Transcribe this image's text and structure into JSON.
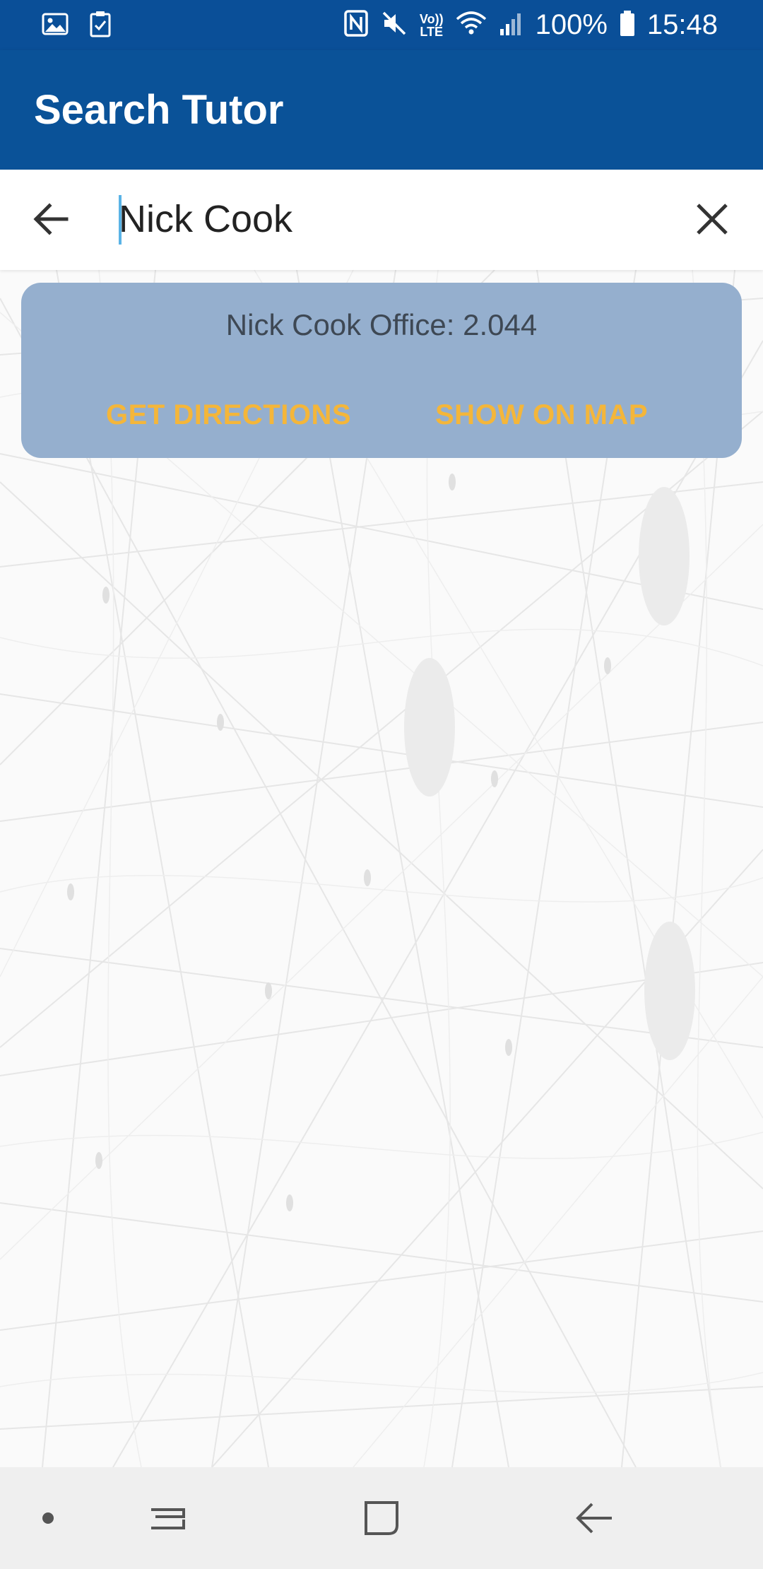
{
  "status_bar": {
    "battery_text": "100%",
    "time": "15:48",
    "lte_top": "Vo))",
    "lte_bottom": "LTE",
    "icons": [
      "gallery-icon",
      "clipboard-check-icon",
      "nfc-icon",
      "mute-icon",
      "volte-icon",
      "wifi-icon",
      "signal-icon",
      "battery-icon"
    ]
  },
  "app_bar": {
    "title": "Search Tutor"
  },
  "search": {
    "value": "Nick Cook",
    "icons": [
      "arrow-back-icon",
      "close-icon"
    ]
  },
  "result": {
    "text": "Nick Cook Office: 2.044",
    "get_directions_label": "GET DIRECTIONS",
    "show_on_map_label": "SHOW ON MAP"
  },
  "nav_bar": {
    "icons": [
      "dot-icon",
      "recent-apps-icon",
      "home-icon",
      "back-icon"
    ]
  },
  "colors": {
    "status_bar": "#0a4f98",
    "app_bar": "#0a5298",
    "card": "#95afce",
    "card_button": "#f4b63a",
    "nav_bar": "#efefef"
  }
}
